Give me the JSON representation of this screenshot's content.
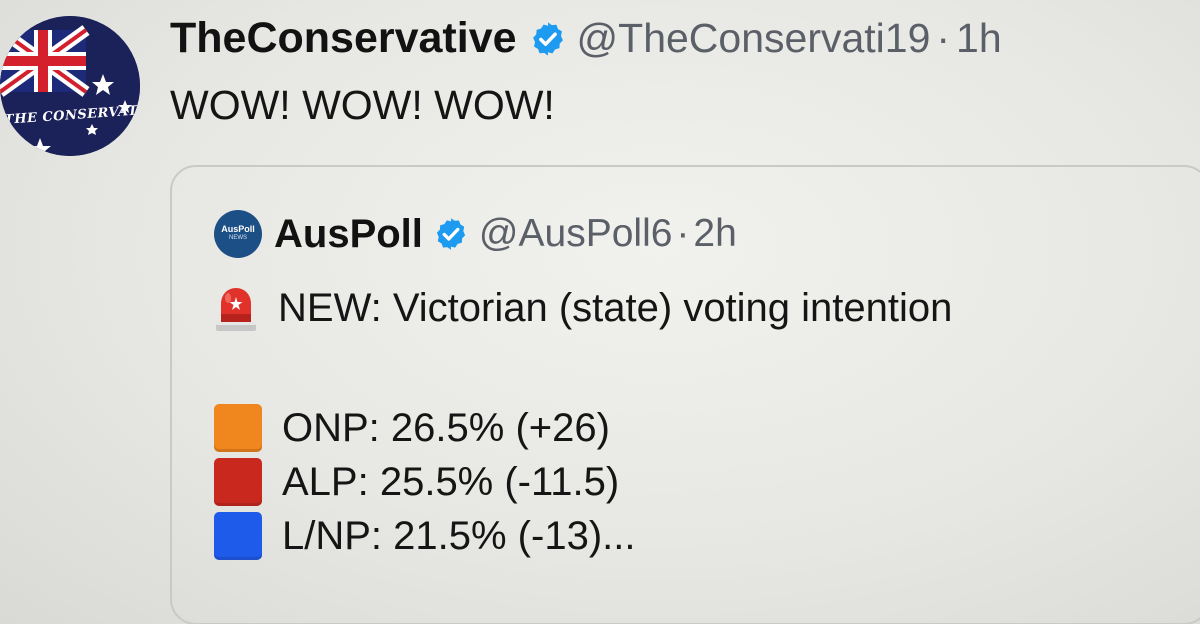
{
  "tweet": {
    "avatar_text": "THE CONSERVATIV",
    "display_name": "TheConservative",
    "handle": "@TheConservati19",
    "separator": "·",
    "time": "1h",
    "text": "WOW! WOW! WOW!"
  },
  "quote": {
    "avatar_text": "AusPoll",
    "avatar_subtext": "NEWS",
    "display_name": "AusPoll",
    "handle": "@AusPoll6",
    "separator": "·",
    "time": "2h",
    "headline": "NEW: Victorian (state) voting intention",
    "results": [
      {
        "text": "ONP: 26.5% (+26)",
        "color": "#f0861e"
      },
      {
        "text": "ALP: 25.5% (-11.5)",
        "color": "#c8281e"
      },
      {
        "text": "L/NP: 21.5% (-13)...",
        "color": "#1f5bea"
      }
    ]
  },
  "icons": {
    "verified": "verified-badge-icon",
    "siren": "rotating-light-icon"
  },
  "colors": {
    "verified_blue": "#1d9bf0",
    "siren_red": "#e0312a"
  }
}
